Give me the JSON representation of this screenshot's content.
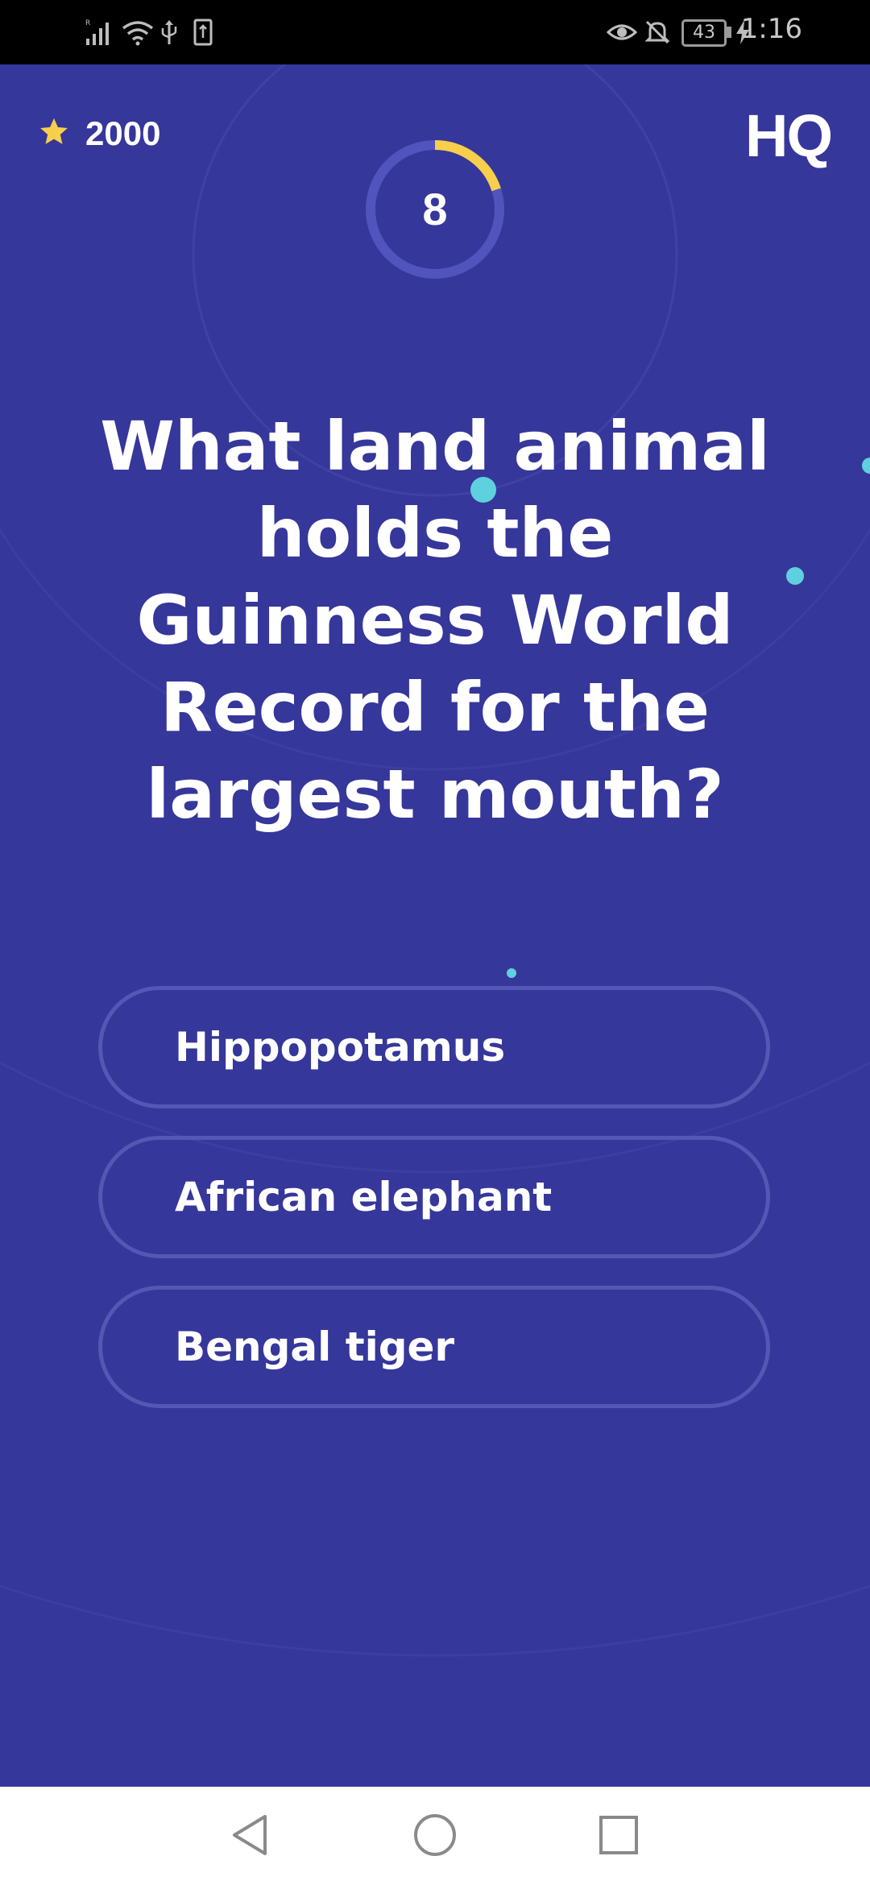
{
  "status_bar": {
    "time": "1:16",
    "battery": "43",
    "icons": [
      "signal-icon",
      "wifi-icon",
      "usb-icon",
      "sim-icon",
      "eye-icon",
      "bell-off-icon",
      "battery-icon",
      "charging-icon"
    ]
  },
  "game": {
    "score": "2000",
    "score_icon": "star-icon",
    "logo": "HQ",
    "timer": {
      "value": "8",
      "remaining_fraction": 0.2
    },
    "question": "What land animal holds the Guinness World Record for the largest mouth?",
    "answers": [
      {
        "label": "Hippopotamus"
      },
      {
        "label": "African elephant"
      },
      {
        "label": "Bengal tiger"
      }
    ]
  },
  "colors": {
    "background": "#36379a",
    "answer_border": "#5557b5",
    "timer_track": "#5254bd",
    "timer_progress": "#f7cf4a",
    "star": "#f7cf4a",
    "accent_dot": "#5fd0dd",
    "ring": "#3f41a6"
  },
  "nav_bar": {
    "icons": [
      "back-icon",
      "home-icon",
      "recents-icon"
    ]
  }
}
